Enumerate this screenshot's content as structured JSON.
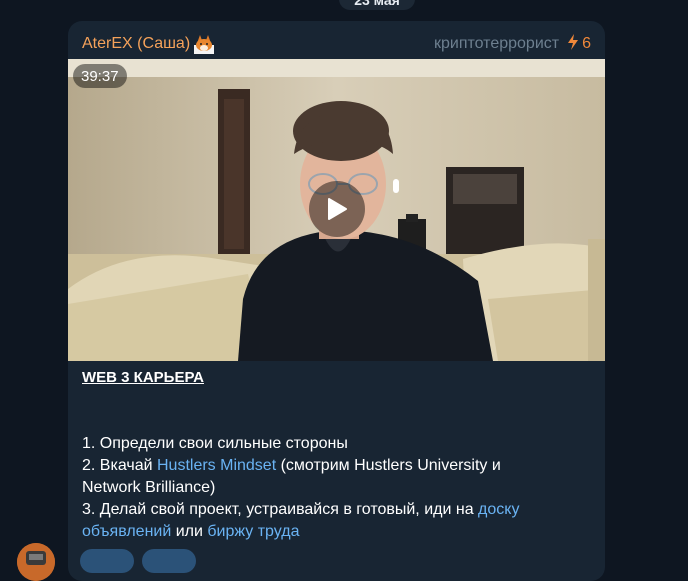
{
  "date_separator": "23 мая",
  "message": {
    "sender": "AterEX (Саша)",
    "sender_emoji": "fox-emoji",
    "author_signature": "криптотеррорист",
    "boost_icon": "lightning-icon",
    "boost_count": "6",
    "video": {
      "duration": "39:37",
      "play_icon": "play-icon"
    },
    "title": "WEB 3 КАРЬЕРА",
    "lines": {
      "l1": "1. Определи свои сильные стороны",
      "l2_prefix": "2. Вкачай ",
      "l2_link": "Hustlers Mindset",
      "l2_suffix": " (смотрим Hustlers University и",
      "l3": "Network Brilliance)",
      "l4_prefix": "3. Делай свой проект, устраивайся в готовый, иди на ",
      "l4_link": "доску",
      "l5_link": "объявлений",
      "l5_mid": " или ",
      "l5_link2": "биржу труда"
    }
  },
  "colors": {
    "background": "#0e1621",
    "bubble": "#182533",
    "sender_name": "#f5a25a",
    "link": "#6ab3f3",
    "signature": "#6d7f8f",
    "boost": "#f0883a"
  }
}
